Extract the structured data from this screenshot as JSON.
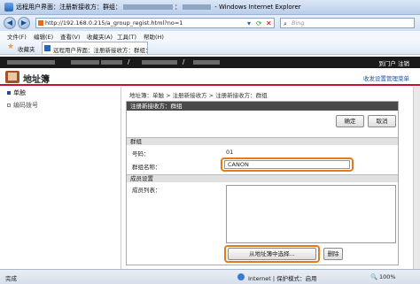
{
  "window": {
    "title_prefix": "远程用户界面：注册新接收方：群组：",
    "title_mid": "：",
    "title_suffix": "- Windows Internet Explorer"
  },
  "address": {
    "url": "http://192.168.0.215/a_group_regist.html?no=1",
    "search_placeholder": "Bing"
  },
  "menu": [
    "文件(F)",
    "编辑(E)",
    "查看(V)",
    "收藏夹(A)",
    "工具(T)",
    "帮助(H)"
  ],
  "favorites": {
    "label": "收藏夹",
    "tab_title": "远程用户界面：注册新接收方：群组："
  },
  "header": {
    "links": "到门户  注销",
    "title": "地址簿",
    "right_link": "收发设置管理菜单"
  },
  "sidebar": {
    "items": [
      {
        "label": "单触"
      },
      {
        "label": "编码拨号"
      }
    ]
  },
  "content": {
    "breadcrumb": "地址簿：单触 > 注册新接收方 > 注册新接收方：群组",
    "panel_title": "注册新接收方：群组",
    "ok_button": "确定",
    "cancel_button": "取消",
    "group_section": "群组",
    "number_label": "号码：",
    "number_value": "01",
    "name_label": "群组名称：",
    "name_value": "CANON",
    "members_section": "成员设置",
    "members_label": "成员列表：",
    "select_button": "从地址簿中选择...",
    "delete_button": "删除"
  },
  "status": {
    "left": "完成",
    "zone": "Internet | 保护模式：启用",
    "zoom": "100%"
  },
  "colors": {
    "accent": "#c8102e",
    "highlight": "#e47a1c"
  }
}
